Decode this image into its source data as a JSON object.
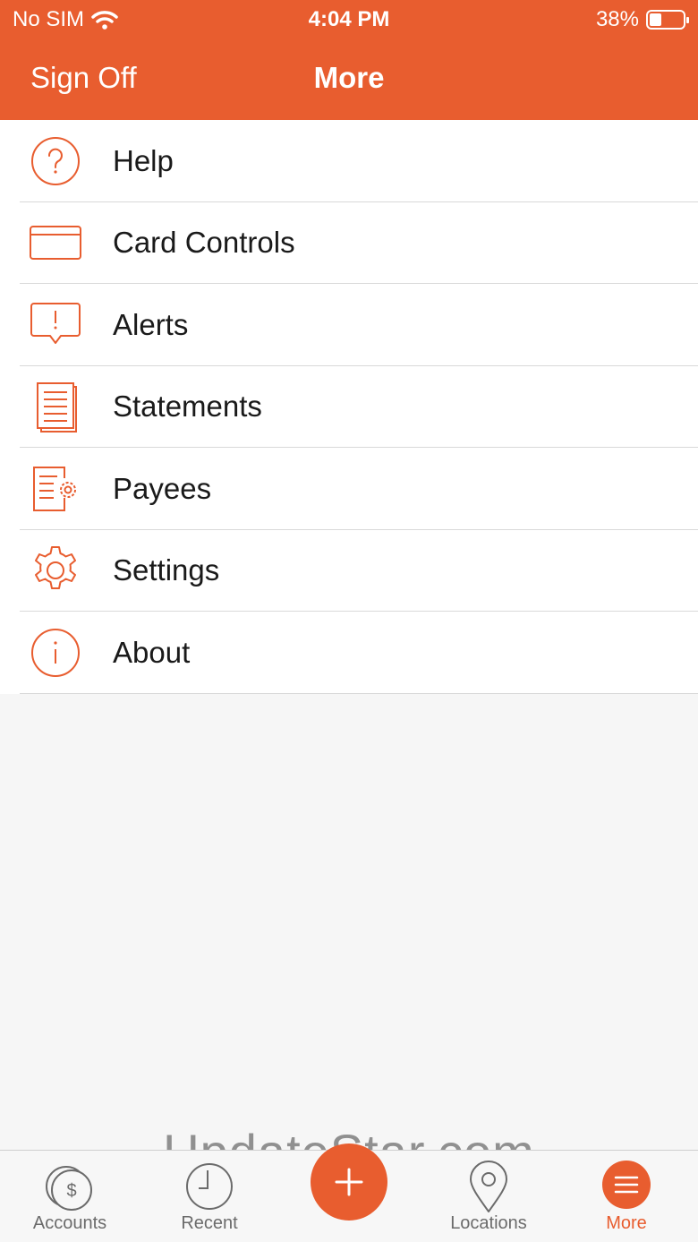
{
  "status_bar": {
    "carrier": "No SIM",
    "time": "4:04 PM",
    "battery": "38%"
  },
  "nav": {
    "left_button": "Sign Off",
    "title": "More"
  },
  "menu": {
    "items": [
      {
        "label": "Help",
        "icon": "help-icon"
      },
      {
        "label": "Card Controls",
        "icon": "card-icon"
      },
      {
        "label": "Alerts",
        "icon": "alert-icon"
      },
      {
        "label": "Statements",
        "icon": "statements-icon"
      },
      {
        "label": "Payees",
        "icon": "payees-icon"
      },
      {
        "label": "Settings",
        "icon": "gear-icon"
      },
      {
        "label": "About",
        "icon": "info-icon"
      }
    ]
  },
  "tabbar": {
    "tabs": [
      {
        "label": "Accounts",
        "icon": "accounts-icon"
      },
      {
        "label": "Recent",
        "icon": "clock-icon"
      },
      {
        "label": "Locations",
        "icon": "location-pin-icon"
      },
      {
        "label": "More",
        "icon": "menu-icon"
      }
    ],
    "active": "More",
    "fab_icon": "plus-icon"
  },
  "watermark": "UpdateStar.com",
  "colors": {
    "accent": "#e85d2f",
    "background": "#f6f6f6",
    "tab_inactive": "#6b6b6b"
  }
}
